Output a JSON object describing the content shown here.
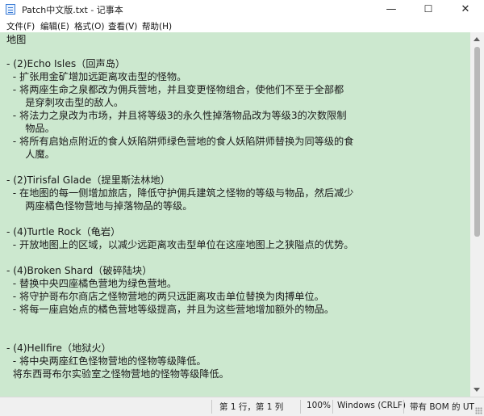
{
  "window": {
    "title": "Patch中文版.txt - 记事本",
    "minimize": "—",
    "maximize": "☐",
    "close": "✕"
  },
  "menu": [
    "文件(F)",
    "编辑(E)",
    "格式(O)",
    "查看(V)",
    "帮助(H)"
  ],
  "content": {
    "lines": [
      "地图",
      "",
      "- (2)Echo Isles（回声岛）",
      "  - 扩张用金矿增加远距离攻击型的怪物。",
      "  - 将两座生命之泉都改为佣兵营地，并且变更怪物组合，使他们不至于全部都",
      "      是穿刺攻击型的敌人。",
      "  - 将法力之泉改为市场，并且将等级3的永久性掉落物品改为等级3的次数限制",
      "      物品。",
      "  - 将所有启始点附近的食人妖陷阱师绿色营地的食人妖陷阱师替换为同等级的食",
      "      人魔。",
      "",
      "- (2)Tirisfal Glade（提里斯法林地）",
      "  - 在地图的每一侧增加旅店，降低守护佣兵建筑之怪物的等级与物品，然后减少",
      "      两座橘色怪物营地与掉落物品的等级。",
      "",
      "- (4)Turtle Rock（龟岩）",
      "  - 开放地图上的区域，以减少远距离攻击型单位在这座地图上之狭隘点的优势。",
      "",
      "- (4)Broken Shard（破碎陆块）",
      "  - 替换中央四座橘色营地为绿色营地。",
      "  - 将守护哥布尔商店之怪物营地的两只远距离攻击单位替换为肉搏单位。",
      "  - 将每一座启始点的橘色营地等级提高，并且为这些营地增加额外的物品。",
      "",
      "",
      "- (4)Hellfire（地狱火）",
      "  - 将中央两座红色怪物营地的怪物等级降低。",
      "  将东西哥布尔实验室之怪物营地的怪物等级降低。"
    ]
  },
  "status": {
    "position": "第 1 行，第 1 列",
    "zoom": "100%",
    "line_ending": "Windows (CRLF)",
    "encoding": "带有 BOM 的 UT"
  }
}
